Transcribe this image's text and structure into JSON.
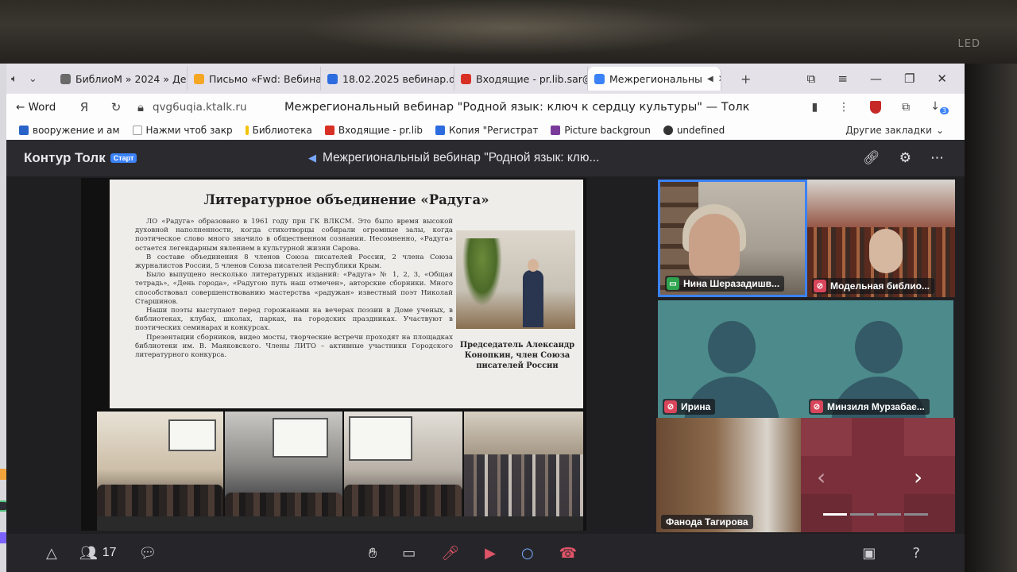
{
  "environment": {
    "monitor_label": "LED"
  },
  "browser": {
    "tabs": [
      {
        "label": "БиблиоМ » 2024 » Дека",
        "favicon_color": "#6a6a6a",
        "active": false
      },
      {
        "label": "Письмо «Fwd: Вебинар",
        "favicon_color": "#f5a623",
        "active": false
      },
      {
        "label": "18.02.2025 вебинар.doc",
        "favicon_color": "#2d6cdf",
        "active": false
      },
      {
        "label": "Входящие - pr.lib.sar@g",
        "favicon_color": "#d93025",
        "active": false
      },
      {
        "label": "Межрегиональны",
        "favicon_color": "#3b82f6",
        "active": true
      }
    ],
    "back_label": "Word",
    "url": "qvg6uqia.ktalk.ru",
    "page_title": "Межрегиональный вебинар \"Родной язык: ключ к сердцу культуры\" — Толк",
    "downloads_count": "3",
    "bookmarks": [
      {
        "label": "вооружение и ам",
        "color": "#2a63c7"
      },
      {
        "label": "Нажми чтоб закр",
        "color": "#9a9a9a"
      },
      {
        "label": "Библиотека",
        "color": "#f2c200"
      },
      {
        "label": "Входящие - pr.lib",
        "color": "#d93025"
      },
      {
        "label": "Копия \"Регистрат",
        "color": "#2d6cdf"
      },
      {
        "label": "Picture backgroun",
        "color": "#7a3a9a"
      },
      {
        "label": "undefined",
        "color": "#333333"
      }
    ],
    "other_bookmarks": "Другие закладки"
  },
  "app": {
    "brand": "Контур Толк",
    "brand_badge": "Старт",
    "meeting_title": "Межрегиональный вебинар \"Родной язык: клю...",
    "participants_count": "17",
    "accent_color": "#3b82f6",
    "mute_color": "#d9465b"
  },
  "slide": {
    "heading": "Литературное объединение «Радуга»",
    "paragraphs": [
      "ЛО «Радуга» образовано в 1961 году при ГК ВЛКСМ. Это было время высокой духовной наполненности, когда стихотворцы собирали огромные залы, когда поэтическое слово много значило в общественном сознании. Несомненно, «Радуга» остается легендарным явлением в культурной жизни Сарова.",
      "В составе объединения 8 членов Союза писателей России, 2 члена Союза журналистов России, 5 членов Союза писателей Республики Крым.",
      "Было выпущено несколько литературных изданий: «Радуга» № 1, 2, 3, «Общая тетрадь», «День города», «Радугою путь наш отмечен», авторские сборники. Много способствовал совершенствованию мастерства «радужан» известный поэт Николай Старшинов.",
      "Наши поэты выступают перед горожанами на вечерах поэзии в Доме ученых, в библиотеках, клубах, школах, парках, на городских праздниках. Участвуют в поэтических семинарах и конкурсах.",
      "Презентации сборников, видео мосты, творческие встречи проходят на площадках библиотеки им. В. Маяковского. Члены ЛИТО – активные участники Городского литературного конкурса."
    ],
    "caption": "Председатель Александр Конопкин, член Союза писателей России"
  },
  "participants": [
    {
      "name": "Нина Шеразадишв...",
      "mic": "on"
    },
    {
      "name": "Модельная библио...",
      "mic": "muted"
    },
    {
      "name": "Ирина",
      "mic": "muted"
    },
    {
      "name": "Минзиля Мурзабае...",
      "mic": "muted"
    },
    {
      "name": "Фанода Тагирова",
      "mic": "none"
    }
  ]
}
